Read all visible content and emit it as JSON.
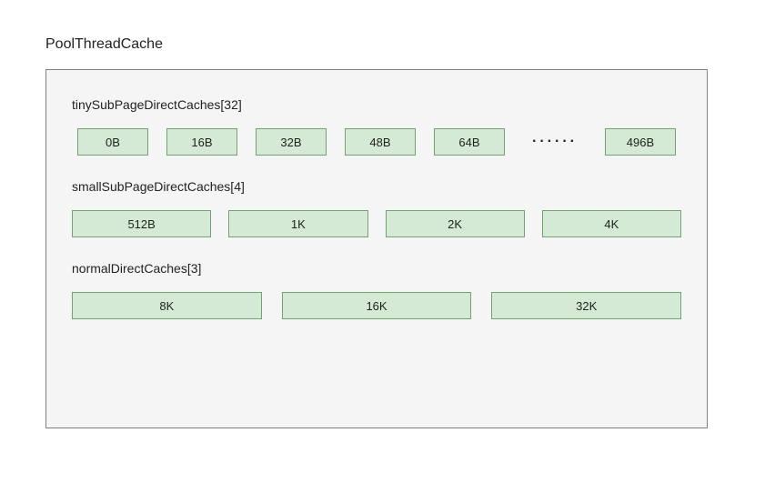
{
  "title": "PoolThreadCache",
  "tiny": {
    "label": "tinySubPageDirectCaches[32]",
    "values": [
      "0B",
      "16B",
      "32B",
      "48B",
      "64B"
    ],
    "ellipsis": "······",
    "last": "496B"
  },
  "small": {
    "label": "smallSubPageDirectCaches[4]",
    "values": [
      "512B",
      "1K",
      "2K",
      "4K"
    ]
  },
  "normal": {
    "label": "normalDirectCaches[3]",
    "values": [
      "8K",
      "16K",
      "32K"
    ]
  }
}
